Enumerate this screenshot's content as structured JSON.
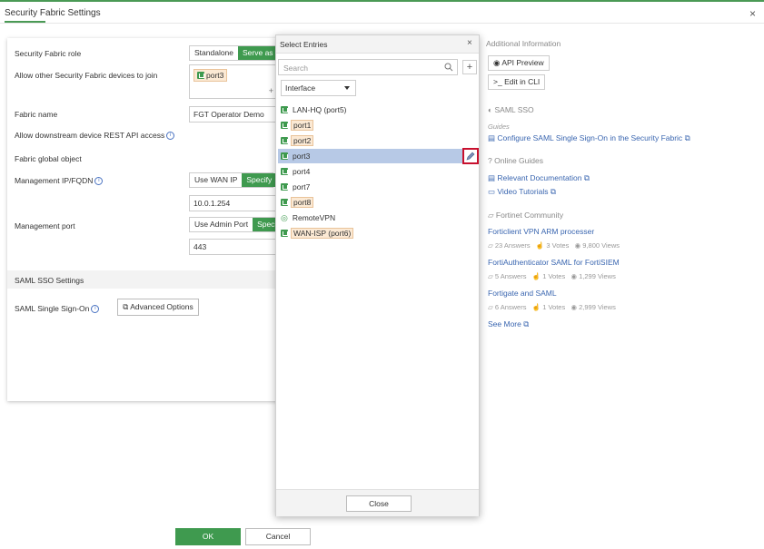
{
  "window": {
    "title": "Security Fabric Settings",
    "close_label": "×"
  },
  "form": {
    "role_label": "Security Fabric role",
    "role_options": [
      "Standalone",
      "Serve as Fa"
    ],
    "allow_join_label": "Allow other Security Fabric devices to join",
    "allow_join_tag": "port3",
    "fabric_name_label": "Fabric name",
    "fabric_name_value": "FGT Operator Demo",
    "rest_api_label": "Allow downstream device REST API access",
    "global_object_label": "Fabric global object",
    "mgmt_ip_label": "Management IP/FQDN",
    "mgmt_ip_options": [
      "Use WAN IP",
      "Specify"
    ],
    "mgmt_ip_value": "10.0.1.254",
    "mgmt_port_label": "Management port",
    "mgmt_port_options": [
      "Use Admin Port",
      "Specif"
    ],
    "mgmt_port_value": "443",
    "saml_section": "SAML SSO Settings",
    "saml_label": "SAML Single Sign-On",
    "advanced_options": "Advanced Options"
  },
  "dialog": {
    "title": "Select Entries",
    "search_placeholder": "Search",
    "filter_value": "Interface",
    "entries": [
      {
        "name": "LAN-HQ (port5)",
        "highlight": false,
        "selected": false
      },
      {
        "name": "port1",
        "highlight": true,
        "selected": false
      },
      {
        "name": "port2",
        "highlight": true,
        "selected": false
      },
      {
        "name": "port3",
        "highlight": false,
        "selected": true
      },
      {
        "name": "port4",
        "highlight": false,
        "selected": false
      },
      {
        "name": "port7",
        "highlight": false,
        "selected": false
      },
      {
        "name": "port8",
        "highlight": true,
        "selected": false
      },
      {
        "name": "RemoteVPN",
        "highlight": false,
        "selected": false
      },
      {
        "name": "WAN-ISP (port6)",
        "highlight": true,
        "selected": false
      }
    ],
    "close_button": "Close"
  },
  "sidebar": {
    "additional_info": "Additional Information",
    "api_preview": "API Preview",
    "edit_cli": "Edit in CLI",
    "saml_sso": "SAML SSO",
    "guides": "Guides",
    "guide_link": "Configure SAML Single Sign-On in the Security Fabric",
    "online_guides": "Online Guides",
    "relevant_docs": "Relevant Documentation",
    "video_tutorials": "Video Tutorials",
    "community": "Fortinet Community",
    "posts": [
      {
        "title": "Forticlient VPN ARM processer",
        "answers": "23 Answers",
        "votes": "3 Votes",
        "views": "9,800 Views"
      },
      {
        "title": "FortiAuthenticator SAML for FortiSIEM",
        "answers": "5 Answers",
        "votes": "1 Votes",
        "views": "1,299 Views"
      },
      {
        "title": "Fortigate and SAML",
        "answers": "6 Answers",
        "votes": "1 Votes",
        "views": "2,999 Views"
      }
    ],
    "see_more": "See More"
  },
  "footer": {
    "ok": "OK",
    "cancel": "Cancel"
  }
}
